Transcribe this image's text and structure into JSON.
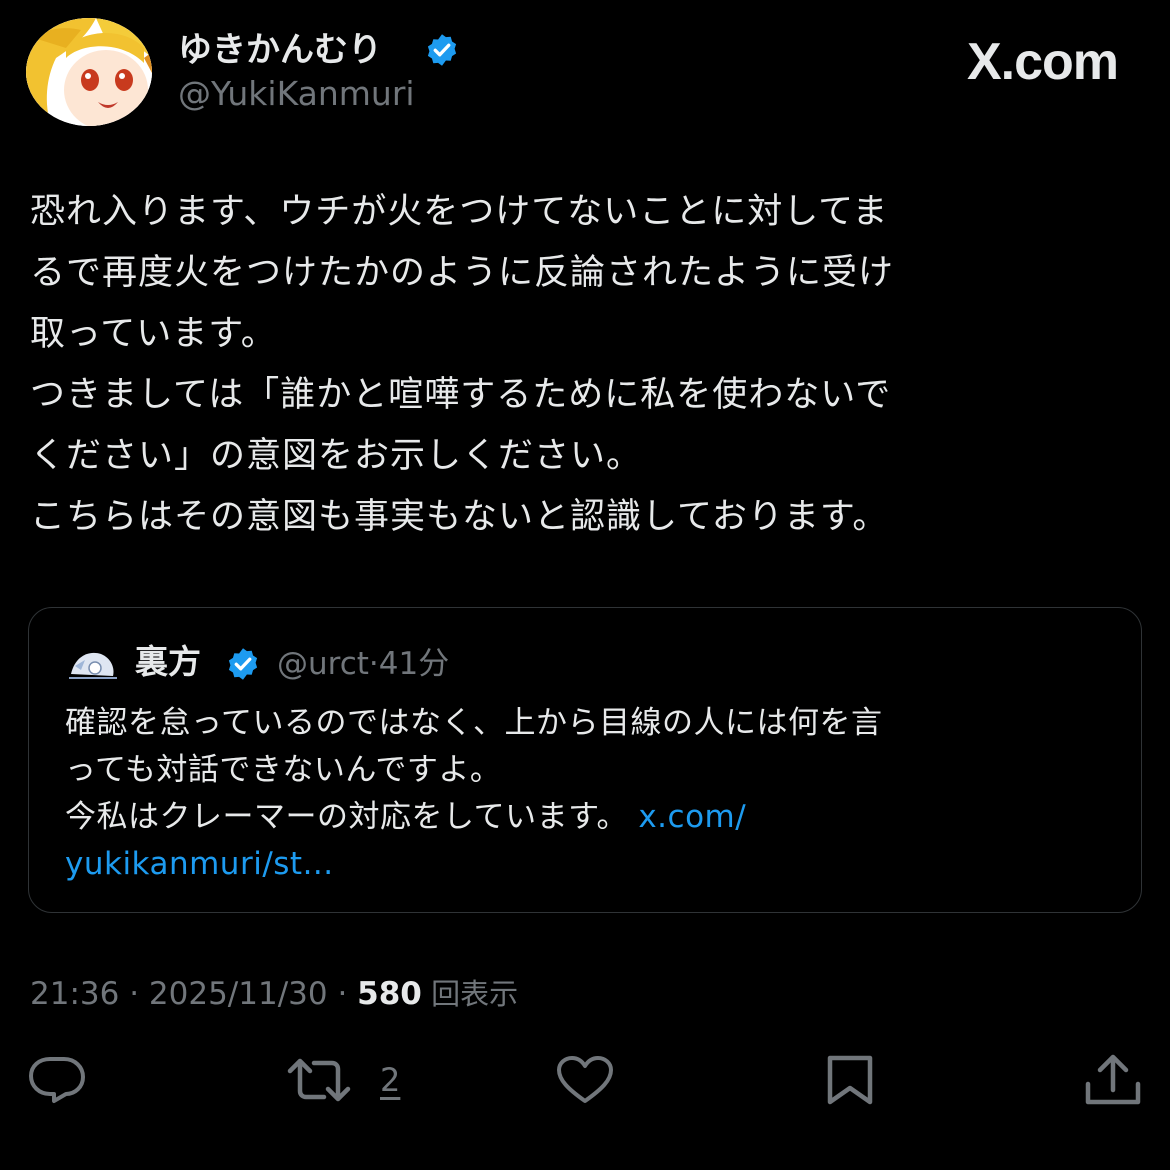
{
  "author": {
    "display_name": "ゆきかんむり",
    "handle": "@YukiKanmuri",
    "verified": true
  },
  "brand": "X.com",
  "tweet": {
    "text": "恐れ入ります、ウチが火をつけてないことに対してま\nるで再度火をつけたかのように反論されたように受け\n取っています。\nつきましては「誰かと喧嘩するために私を使わないで\nください」の意図をお示しください。\nこちらはその意図も事実もないと認識しております。"
  },
  "quote": {
    "name": "裏方",
    "handle": "@urct",
    "separator": "·",
    "time": "41分",
    "lines": [
      "確認を怠っているのではなく、上から目線の人には何を言",
      "っても対話できないんですよ。",
      "今私はクレーマーの対応をしています。 "
    ],
    "link_part1": "x.com/",
    "link_part2": "yukikanmuri/st..."
  },
  "meta": {
    "time": "21:36",
    "sep1": " · ",
    "date": "2025/11/30",
    "sep2": " · ",
    "views": "580",
    "views_label": " 回表示"
  },
  "actions": {
    "retweet_count": "2"
  },
  "colors": {
    "background": "#000000",
    "text": "#e7e9ea",
    "muted": "#71767b",
    "accent": "#1d9bf0",
    "border": "#2f3336"
  },
  "icons": [
    "verified-badge-icon",
    "reply-icon",
    "retweet-icon",
    "like-icon",
    "bookmark-icon",
    "share-icon"
  ]
}
